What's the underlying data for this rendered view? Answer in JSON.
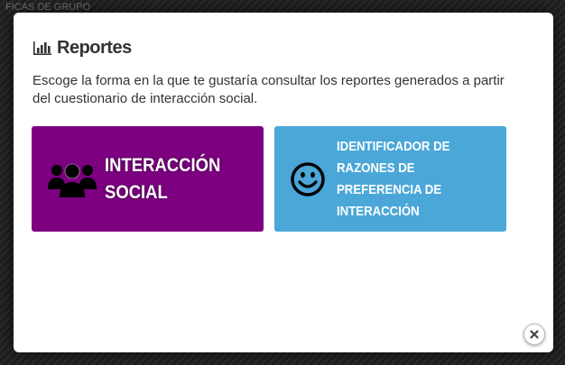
{
  "background": {
    "header_text": "FICAS DE GRUPO"
  },
  "modal": {
    "title": "Reportes",
    "title_icon": "bar-chart-icon",
    "description": "Escoge la forma en la que te gustaría consultar los reportes generados a partir del cuestionario de interacción social.",
    "tiles": [
      {
        "label": "INTERACCIÓN SOCIAL",
        "icon": "group-icon",
        "color": "#7d0080"
      },
      {
        "label": "IDENTIFICADOR DE RAZONES DE PREFERENCIA DE INTERACCIÓN",
        "icon": "smiley-icon",
        "color": "#4aa7d8"
      }
    ],
    "close_icon": "close-icon"
  }
}
